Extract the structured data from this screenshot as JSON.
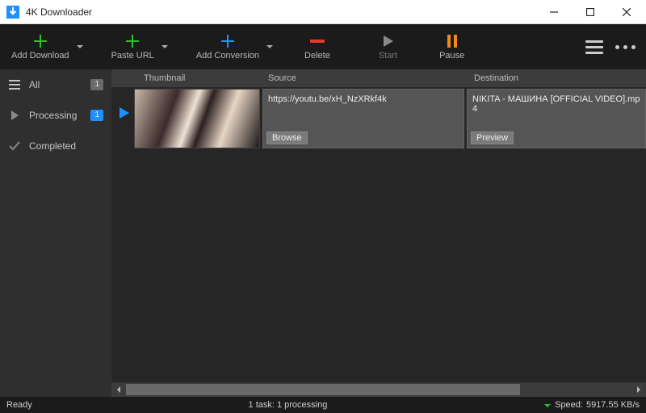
{
  "window": {
    "title": "4K Downloader"
  },
  "toolbar": {
    "addDownload": "Add Download",
    "pasteUrl": "Paste URL",
    "addConversion": "Add Conversion",
    "delete": "Delete",
    "start": "Start",
    "pause": "Pause"
  },
  "sidebar": {
    "all": {
      "label": "All",
      "count": "1"
    },
    "processing": {
      "label": "Processing",
      "count": "1"
    },
    "completed": {
      "label": "Completed"
    }
  },
  "columns": {
    "thumbnail": "Thumbnail",
    "source": "Source",
    "destination": "Destination"
  },
  "row": {
    "source": "https://youtu.be/xH_NzXRkf4k",
    "browse": "Browse",
    "destination": "NIKITA - МАШИНА [OFFICIAL VIDEO].mp4",
    "preview": "Preview"
  },
  "status": {
    "ready": "Ready",
    "tasks": "1 task: 1 processing",
    "speedLabel": "Speed:",
    "speedValue": "5917.55 KB/s"
  }
}
